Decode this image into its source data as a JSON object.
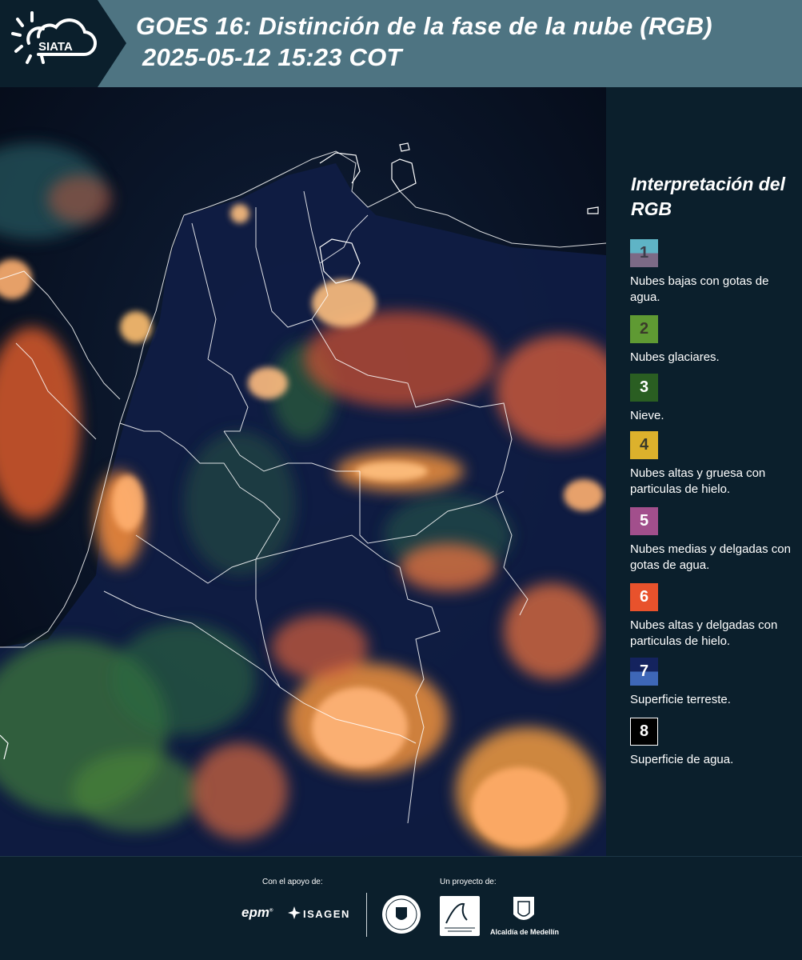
{
  "header": {
    "title_line1": "GOES 16: Distinción de la fase de la nube (RGB)",
    "title_line2": "2025-05-12 15:23 COT",
    "logo_text": "SIATA"
  },
  "legend": {
    "title": "Interpretación del RGB",
    "items": [
      {
        "number": "1",
        "label": "Nubes bajas con gotas de agua.",
        "color_top": "#5fb4c6",
        "color_bottom": "#7c6a86"
      },
      {
        "number": "2",
        "label": "Nubes glaciares.",
        "color_top": "#5f9a33",
        "color_bottom": "#5f9a33"
      },
      {
        "number": "3",
        "label": "Nieve.",
        "color_top": "#2a5e22",
        "color_bottom": "#2a5e22"
      },
      {
        "number": "4",
        "label": "Nubes altas y gruesa con particulas de hielo.",
        "color_top": "#dcb12c",
        "color_bottom": "#dcb12c"
      },
      {
        "number": "5",
        "label": "Nubes medias y delgadas con gotas de agua.",
        "color_top": "#a24f8c",
        "color_bottom": "#a24f8c"
      },
      {
        "number": "6",
        "label": "Nubes altas y delgadas con particulas de hielo.",
        "color_top": "#e8522c",
        "color_bottom": "#e8522c"
      },
      {
        "number": "7",
        "label": "Superficie terreste.",
        "color_top": "#14235e",
        "color_bottom": "#3e67b7"
      },
      {
        "number": "8",
        "label": "Superficie de agua.",
        "color_top": "#000000",
        "color_bottom": "#000000"
      }
    ]
  },
  "footer": {
    "support_label": "Con el apoyo de:",
    "project_label": "Un proyecto de:",
    "epm": "epm",
    "isagen": "ISAGEN",
    "alcaldia": "Alcaldía de Medellín"
  }
}
